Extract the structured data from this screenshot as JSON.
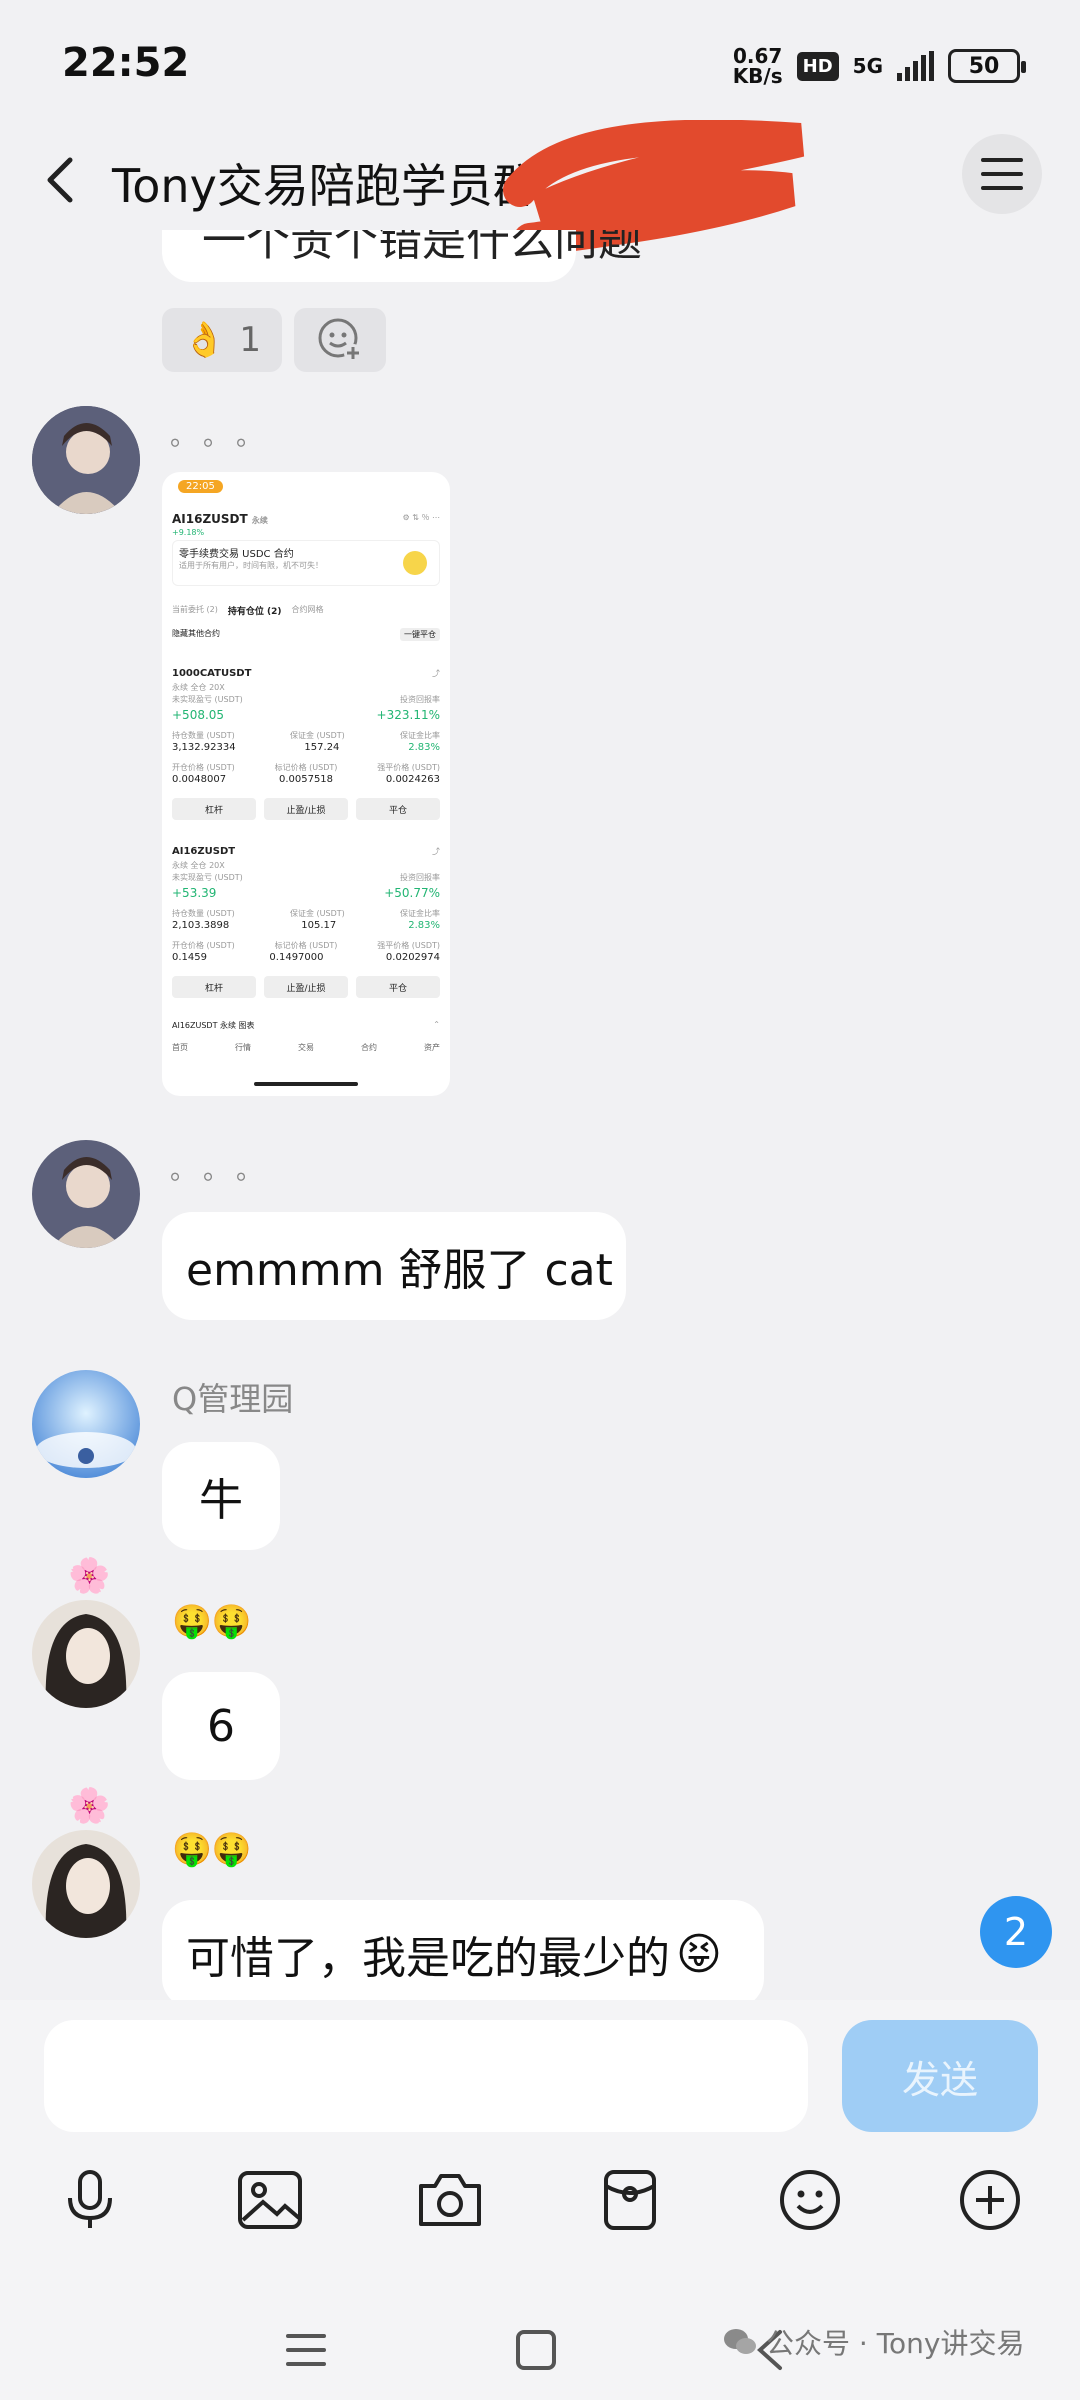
{
  "status": {
    "time": "22:52",
    "speed_value": "0.67",
    "speed_unit": "KB/s",
    "hd": "HD",
    "network": "5G",
    "battery": "50"
  },
  "header": {
    "title": "Tony交易陪跑学员群"
  },
  "messages": {
    "partial_text": "一个贵个错是什么问题",
    "reaction_count": "1",
    "dots1": "。。。",
    "dots2": "。。。",
    "msg_emmmm": "emmmm 舒服了 cat",
    "q_nick": "Q管理园",
    "msg_niu": "牛",
    "emoji_nick1": "🤑🤑",
    "msg_six": "6",
    "emoji_nick2": "🤑🤑",
    "msg_last": "可惜了，我是吃的最少的"
  },
  "shot": {
    "time": "22:05",
    "pair": "AI16ZUSDT",
    "perp": "永续",
    "change": "+9.18%",
    "promo_title": "零手续费交易 USDC 合约",
    "promo_sub": "适用于所有用户，时间有限，机不可失！",
    "tab1": "当前委托 (2)",
    "tab2": "持有仓位 (2)",
    "tab3": "合约网格",
    "hide_other": "隐藏其他合约",
    "close_all": "一键平仓",
    "p1_name": "1000CATUSDT",
    "p1_tag": "永续  全仓 20X",
    "label_upnl": "未实现盈亏 (USDT)",
    "label_roe": "投资回报率",
    "p1_upnl": "+508.05",
    "p1_roe": "+323.11%",
    "label_qty": "持仓数量 (USDT)",
    "label_margin": "保证金 (USDT)",
    "label_ratio": "保证金比率",
    "p1_qty": "3,132.92334",
    "p1_margin": "157.24",
    "p1_ratio": "2.83%",
    "label_entry": "开仓价格 (USDT)",
    "label_mark": "标记价格 (USDT)",
    "label_liq": "强平价格 (USDT)",
    "p1_entry": "0.0048007",
    "p1_mark": "0.0057518",
    "p1_liq": "0.0024263",
    "btn_lev": "杠杆",
    "btn_tpsl": "止盈/止损",
    "btn_close": "平仓",
    "p2_name": "AI16ZUSDT",
    "p2_tag": "永续  全仓 20X",
    "p2_upnl": "+53.39",
    "p2_roe": "+50.77%",
    "p2_qty": "2,103.3898",
    "p2_margin": "105.17",
    "p2_ratio": "2.83%",
    "p2_entry": "0.1459",
    "p2_mark": "0.1497000",
    "p2_liq": "0.0202974",
    "footer": "AI16ZUSDT 永续 图表",
    "nav": [
      "首页",
      "行情",
      "交易",
      "合约",
      "资产"
    ]
  },
  "unread_badge": "2",
  "input": {
    "send_label": "发送",
    "placeholder": ""
  },
  "watermark": "公众号 · Tony讲交易"
}
